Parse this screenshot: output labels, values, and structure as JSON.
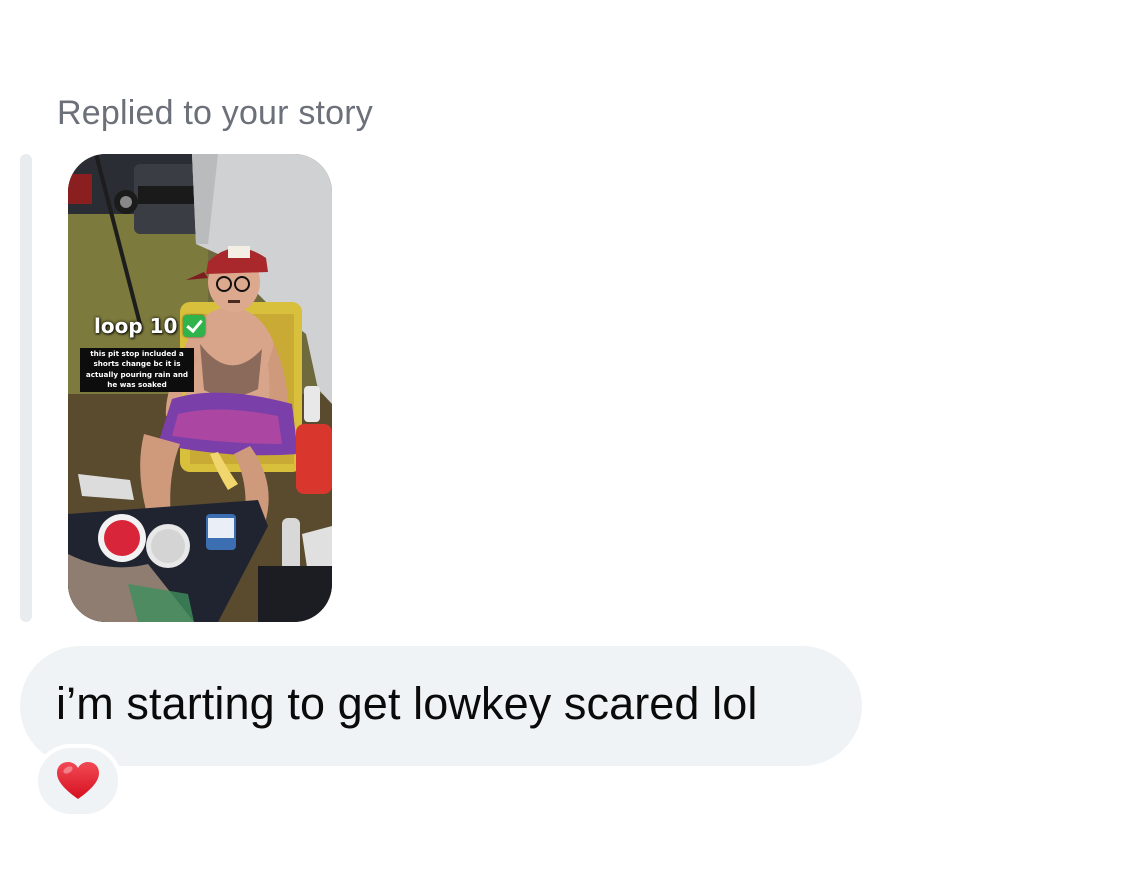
{
  "reply_context": {
    "label": "Replied to your story"
  },
  "story": {
    "overlay_title": "loop 10",
    "overlay_title_icon": "check-mark-button-icon",
    "overlay_caption": "this pit stop included a shorts change bc it is actually pouring rain and he was soaked"
  },
  "message": {
    "text": "i’m starting to get lowkey scared lol",
    "bubble_color": "#f0f3f5"
  },
  "reaction": {
    "icon": "red-heart-icon",
    "color": "#e5202e"
  }
}
